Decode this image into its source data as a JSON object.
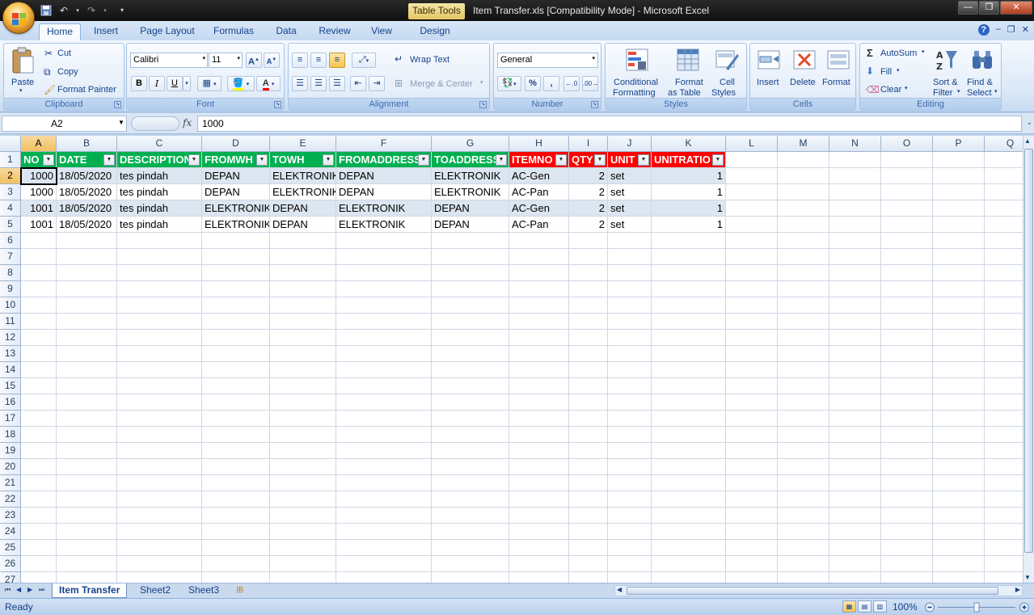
{
  "title": {
    "context_tab": "Table Tools",
    "text": "Item Transfer.xls  [Compatibility Mode]  -  Microsoft Excel",
    "minimize": "—",
    "restore": "❐",
    "close": "✕"
  },
  "ribbon_tabs": [
    "Home",
    "Insert",
    "Page Layout",
    "Formulas",
    "Data",
    "Review",
    "View",
    "Design"
  ],
  "mdi": {
    "help": "?",
    "minimize": "–",
    "restore": "❐",
    "close": "✕"
  },
  "clipboard": {
    "paste": "Paste",
    "cut": "Cut",
    "copy": "Copy",
    "format_painter": "Format Painter",
    "label": "Clipboard"
  },
  "font": {
    "name": "Calibri",
    "size": "11",
    "bold": "B",
    "italic": "I",
    "underline": "U",
    "label": "Font"
  },
  "alignment": {
    "wrap": "Wrap Text",
    "merge": "Merge & Center",
    "label": "Alignment"
  },
  "number": {
    "format": "General",
    "percent": "%",
    "comma": ",",
    "label": "Number"
  },
  "styles": {
    "conditional1": "Conditional",
    "conditional2": "Formatting",
    "table1": "Format",
    "table2": "as Table",
    "cell1": "Cell",
    "cell2": "Styles",
    "label": "Styles"
  },
  "cells": {
    "insert": "Insert",
    "delete": "Delete",
    "format": "Format",
    "label": "Cells"
  },
  "editing": {
    "autosum": "AutoSum",
    "fill": "Fill",
    "clear": "Clear",
    "sort1": "Sort &",
    "sort2": "Filter",
    "find1": "Find &",
    "find2": "Select",
    "label": "Editing"
  },
  "formula_bar": {
    "name_box": "A2",
    "fx": "fx",
    "value": "1000"
  },
  "columns": [
    "A",
    "B",
    "C",
    "D",
    "E",
    "F",
    "G",
    "H",
    "I",
    "J",
    "K",
    "L",
    "M",
    "N",
    "O",
    "P",
    "Q"
  ],
  "row_numbers": [
    "1",
    "2",
    "3",
    "4",
    "5",
    "6",
    "7",
    "8",
    "9",
    "10",
    "11",
    "12",
    "13",
    "14",
    "15",
    "16",
    "17",
    "18",
    "19",
    "20",
    "21",
    "22",
    "23",
    "24",
    "25",
    "26",
    "27"
  ],
  "table": {
    "headers": [
      "NO",
      "DATE",
      "DESCRIPTION",
      "FROMWH",
      "TOWH",
      "FROMADDRESS",
      "TOADDRESS",
      "ITEMNO",
      "QTY",
      "UNIT",
      "UNITRATIO"
    ],
    "header_colors": [
      "#00b050",
      "#00b050",
      "#00b050",
      "#00b050",
      "#00b050",
      "#00b050",
      "#00b050",
      "#ff0000",
      "#ff0000",
      "#ff0000",
      "#ff0000"
    ],
    "rows": [
      [
        "1000",
        "18/05/2020",
        "tes pindah",
        "DEPAN",
        "ELEKTRONIK",
        "DEPAN",
        "ELEKTRONIK",
        "AC-Gen",
        "2",
        "set",
        "1"
      ],
      [
        "1000",
        "18/05/2020",
        "tes pindah",
        "DEPAN",
        "ELEKTRONIK",
        "DEPAN",
        "ELEKTRONIK",
        "AC-Pan",
        "2",
        "set",
        "1"
      ],
      [
        "1001",
        "18/05/2020",
        "tes pindah",
        "ELEKTRONIK",
        "DEPAN",
        "ELEKTRONIK",
        "DEPAN",
        "AC-Gen",
        "2",
        "set",
        "1"
      ],
      [
        "1001",
        "18/05/2020",
        "tes pindah",
        "ELEKTRONIK",
        "DEPAN",
        "ELEKTRONIK",
        "DEPAN",
        "AC-Pan",
        "2",
        "set",
        "1"
      ]
    ]
  },
  "sheets": [
    "Item Transfer",
    "Sheet2",
    "Sheet3"
  ],
  "status": {
    "ready": "Ready",
    "zoom": "100%"
  }
}
